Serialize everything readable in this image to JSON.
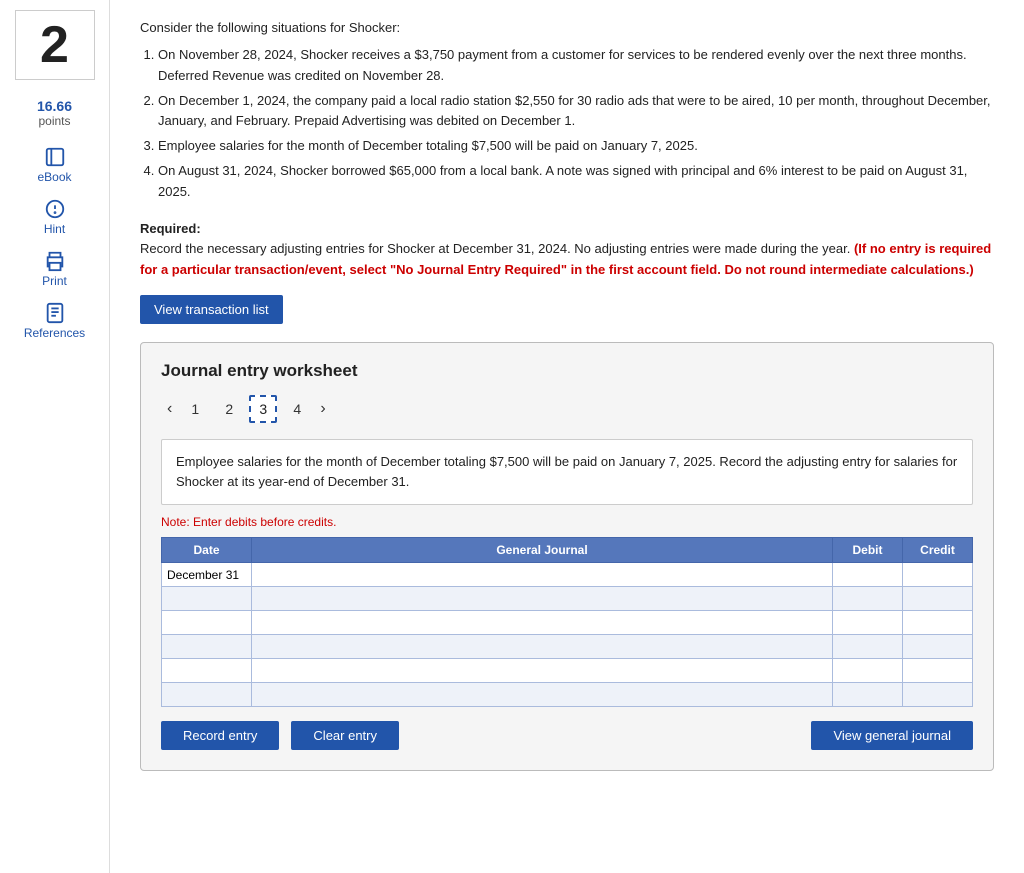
{
  "sidebar": {
    "number": "2",
    "points": "16.66",
    "points_label": "points",
    "items": [
      {
        "id": "ebook",
        "label": "eBook",
        "icon": "book-icon"
      },
      {
        "id": "hint",
        "label": "Hint",
        "icon": "hint-icon"
      },
      {
        "id": "print",
        "label": "Print",
        "icon": "print-icon"
      },
      {
        "id": "references",
        "label": "References",
        "icon": "references-icon"
      }
    ]
  },
  "main": {
    "intro": "Consider the following situations for Shocker:",
    "situations": [
      "On November 28, 2024, Shocker receives a $3,750 payment from a customer for services to be rendered evenly over the next three months. Deferred Revenue was credited on November 28.",
      "On December 1, 2024, the company paid a local radio station $2,550 for 30 radio ads that were to be aired, 10 per month, throughout December, January, and February. Prepaid Advertising was debited on December 1.",
      "Employee salaries for the month of December totaling $7,500 will be paid on January 7, 2025.",
      "On August 31, 2024, Shocker borrowed $65,000 from a local bank. A note was signed with principal and 6% interest to be paid on August 31, 2025."
    ],
    "required_label": "Required:",
    "required_text": "Record the necessary adjusting entries for Shocker at December 31, 2024. No adjusting entries were made during the year.",
    "required_red": "(If no entry is required for a particular transaction/event, select \"No Journal Entry Required\" in the first account field. Do not round intermediate calculations.)",
    "btn_view_transaction": "View transaction list"
  },
  "worksheet": {
    "title": "Journal entry worksheet",
    "tabs": [
      {
        "label": "1",
        "active": false
      },
      {
        "label": "2",
        "active": false
      },
      {
        "label": "3",
        "active": true
      },
      {
        "label": "4",
        "active": false
      }
    ],
    "description": "Employee salaries for the month of December totaling $7,500 will be paid on January 7, 2025. Record the adjusting entry for salaries for Shocker at its year-end of December 31.",
    "note": "Note: Enter debits before credits.",
    "table": {
      "headers": [
        "Date",
        "General Journal",
        "Debit",
        "Credit"
      ],
      "rows": [
        {
          "date": "December 31",
          "journal": "",
          "debit": "",
          "credit": ""
        },
        {
          "date": "",
          "journal": "",
          "debit": "",
          "credit": ""
        },
        {
          "date": "",
          "journal": "",
          "debit": "",
          "credit": ""
        },
        {
          "date": "",
          "journal": "",
          "debit": "",
          "credit": ""
        },
        {
          "date": "",
          "journal": "",
          "debit": "",
          "credit": ""
        },
        {
          "date": "",
          "journal": "",
          "debit": "",
          "credit": ""
        }
      ]
    },
    "btn_record": "Record entry",
    "btn_clear": "Clear entry",
    "btn_view_journal": "View general journal"
  }
}
